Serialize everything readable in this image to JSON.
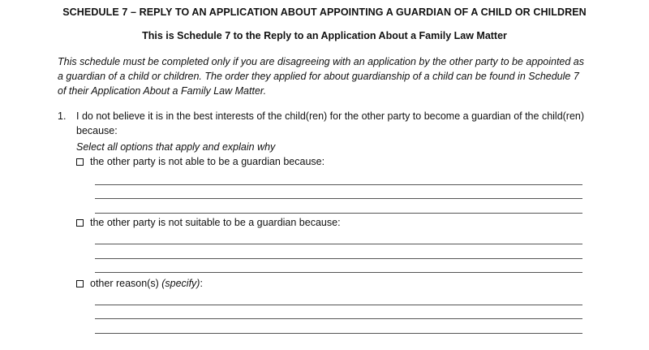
{
  "header": {
    "title": "SCHEDULE 7 – REPLY TO AN APPLICATION ABOUT APPOINTING A GUARDIAN OF A CHILD OR CHILDREN",
    "subtitle": "This is Schedule 7 to the Reply to an Application About a Family Law Matter"
  },
  "intro": {
    "text": "This schedule must be completed only if you are disagreeing with an application by the other party to be appointed as a guardian of a child or children. The order they applied for about guardianship of a child can be found in Schedule 7 of their Application About a Family Law Matter."
  },
  "question1": {
    "number": "1.",
    "text": "I do not believe it is in the best interests of the child(ren) for the other party to become a guardian of the child(ren) because:",
    "hint": "Select all options that apply and explain why",
    "options": [
      {
        "label": "the other party is not able to be a guardian because:",
        "checked": false
      },
      {
        "label": "the other party is not suitable to be a guardian because:",
        "checked": false
      },
      {
        "label": "other reason(s) ",
        "label_italic": "(specify)",
        "label_suffix": ":",
        "checked": false
      }
    ]
  }
}
